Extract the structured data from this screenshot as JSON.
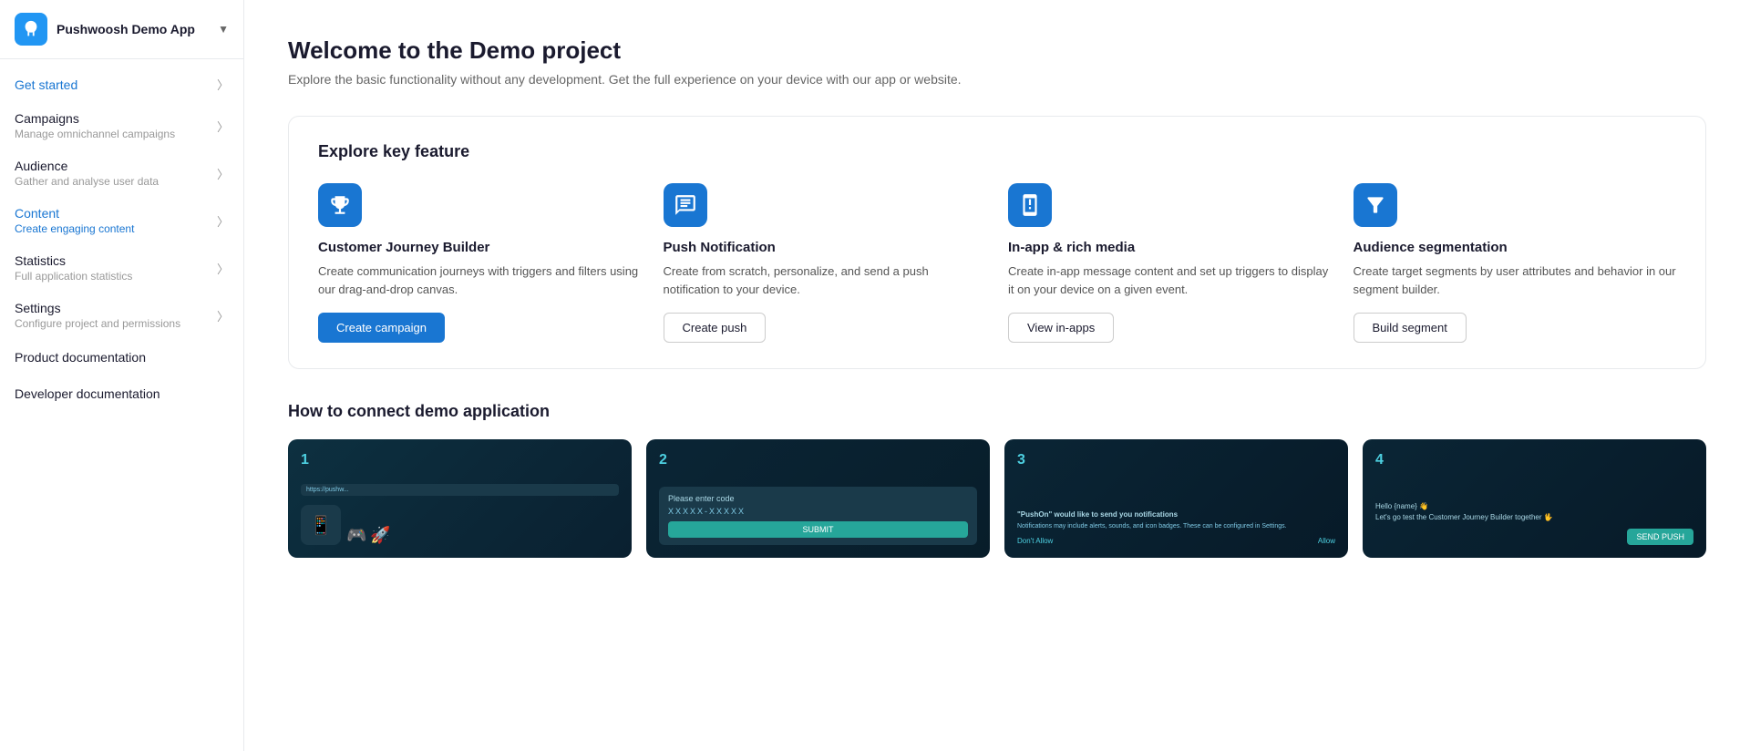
{
  "app": {
    "name": "Pushwoosh Demo App",
    "logo_alt": "Pushwoosh logo"
  },
  "sidebar": {
    "get_started": {
      "title": "Get started",
      "subtitle": null
    },
    "campaigns": {
      "title": "Campaigns",
      "subtitle": "Manage omnichannel campaigns"
    },
    "audience": {
      "title": "Audience",
      "subtitle": "Gather and analyse user data"
    },
    "content": {
      "title": "Content",
      "subtitle": "Create engaging content"
    },
    "statistics": {
      "title": "Statistics",
      "subtitle": "Full application statistics"
    },
    "settings": {
      "title": "Settings",
      "subtitle": "Configure project and permissions"
    },
    "product_docs": "Product documentation",
    "developer_docs": "Developer documentation"
  },
  "main": {
    "title": "Welcome to the Demo project",
    "subtitle": "Explore the basic functionality without any development. Get the full experience on your device with our app or website.",
    "explore_section": {
      "title": "Explore key feature",
      "features": [
        {
          "id": "journey",
          "title": "Customer Journey Builder",
          "description": "Create communication journeys with triggers and filters using our drag-and-drop canvas.",
          "button_label": "Create campaign",
          "button_type": "primary"
        },
        {
          "id": "push",
          "title": "Push Notification",
          "description": "Create from scratch, personalize, and send a push notification to your device.",
          "button_label": "Create push",
          "button_type": "secondary"
        },
        {
          "id": "inapp",
          "title": "In-app & rich media",
          "description": "Create in-app message content and set up triggers to display it on your device on a given event.",
          "button_label": "View in-apps",
          "button_type": "secondary"
        },
        {
          "id": "segment",
          "title": "Audience segmentation",
          "description": "Create target segments by user attributes and behavior in our segment builder.",
          "button_label": "Build segment",
          "button_type": "secondary"
        }
      ]
    },
    "connect_section": {
      "title": "How to connect demo application",
      "steps": [
        {
          "number": "1",
          "visual": "phone-url"
        },
        {
          "number": "2",
          "visual": "enter-code"
        },
        {
          "number": "3",
          "visual": "notification"
        },
        {
          "number": "4",
          "visual": "send-push"
        }
      ]
    }
  }
}
